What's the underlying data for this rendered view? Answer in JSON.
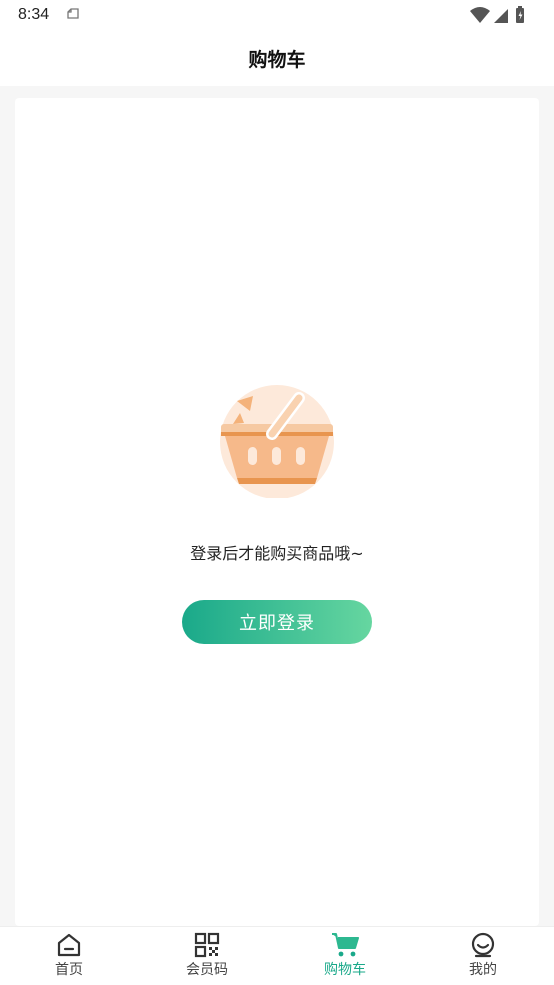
{
  "status_bar": {
    "time": "8:34"
  },
  "header": {
    "title": "购物车"
  },
  "empty_state": {
    "message": "登录后才能购买商品哦~",
    "login_button": "立即登录"
  },
  "tab_bar": {
    "items": [
      {
        "label": "首页",
        "icon": "home-icon",
        "active": false
      },
      {
        "label": "会员码",
        "icon": "qr-code-icon",
        "active": false
      },
      {
        "label": "购物车",
        "icon": "cart-icon",
        "active": true
      },
      {
        "label": "我的",
        "icon": "profile-icon",
        "active": false
      }
    ]
  },
  "colors": {
    "accent": "#1aa98a",
    "accent_light": "#66d6a0",
    "basket": "#f6b98a"
  }
}
